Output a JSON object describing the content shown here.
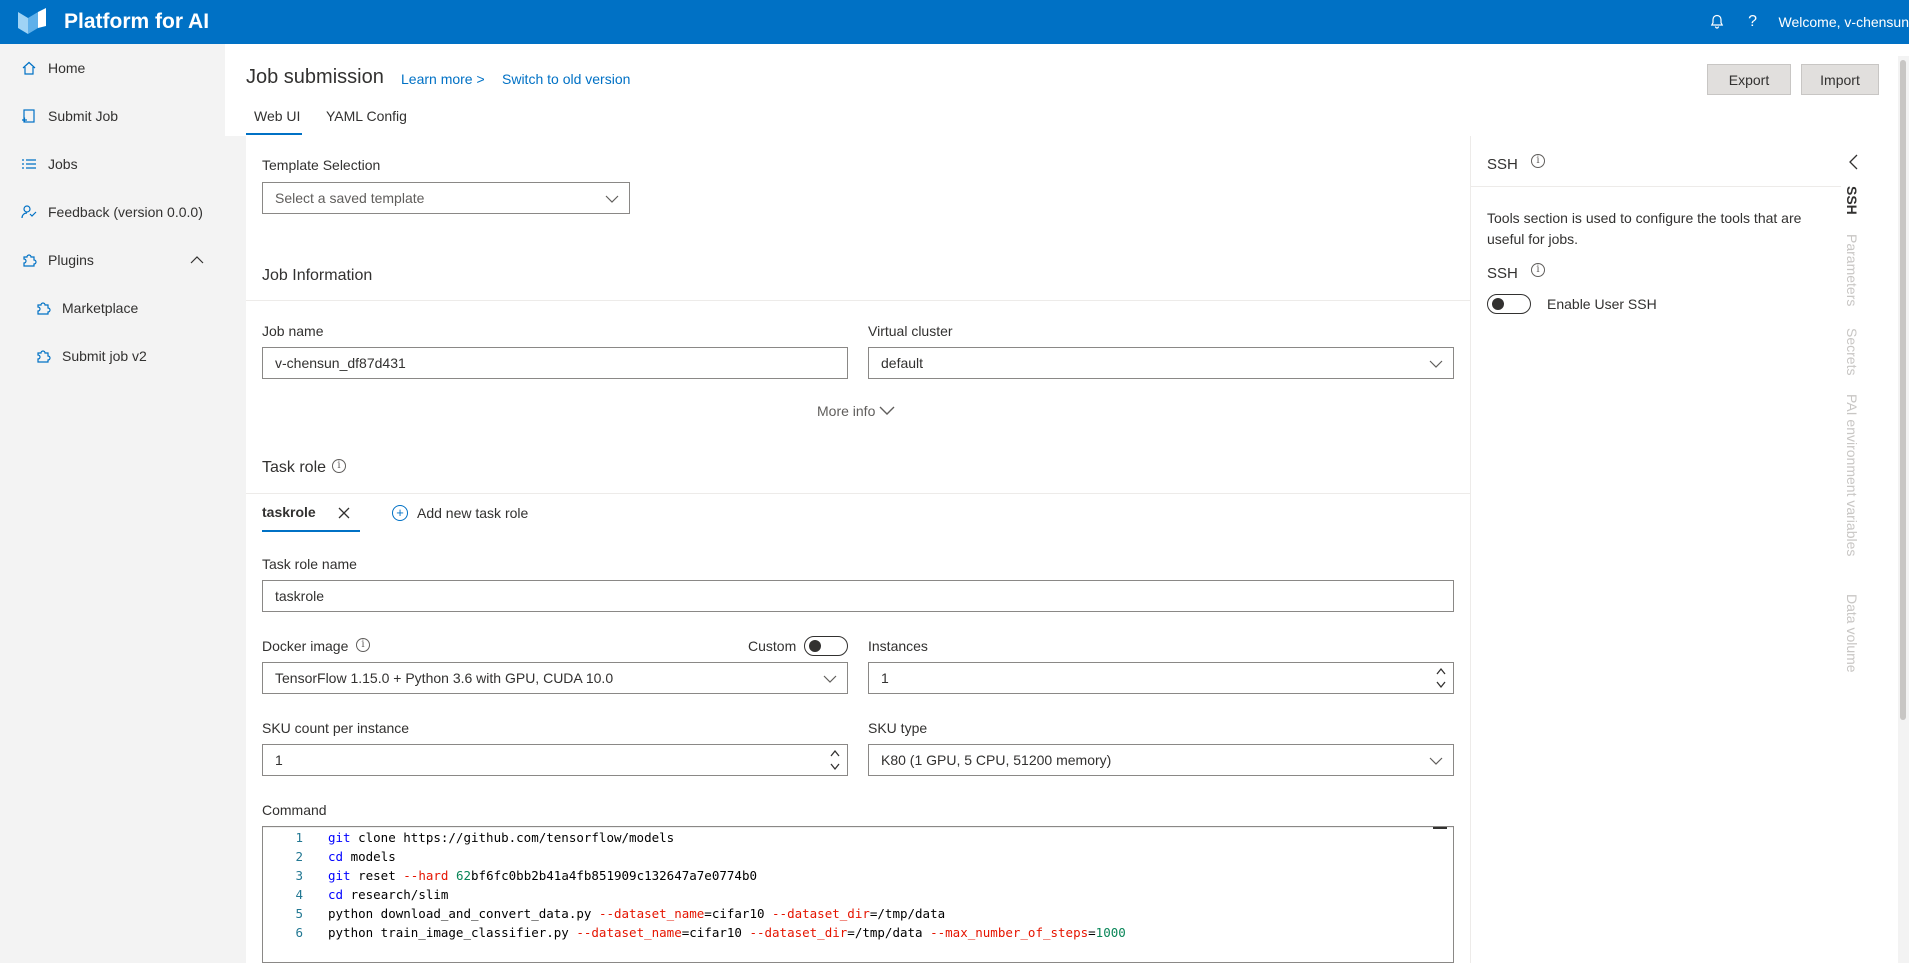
{
  "app": {
    "title": "Platform for AI",
    "welcome": "Welcome, v-chensun"
  },
  "sidebar": {
    "items": [
      {
        "label": "Home"
      },
      {
        "label": "Submit Job"
      },
      {
        "label": "Jobs"
      },
      {
        "label": "Feedback (version 0.0.0)"
      },
      {
        "label": "Plugins"
      },
      {
        "label": "Marketplace"
      },
      {
        "label": "Submit job v2"
      }
    ]
  },
  "header": {
    "title": "Job submission",
    "learn_more": "Learn more >",
    "switch_old": "Switch to old version",
    "export": "Export",
    "import": "Import",
    "tabs": [
      {
        "label": "Web UI"
      },
      {
        "label": "YAML Config"
      }
    ]
  },
  "form": {
    "template_label": "Template Selection",
    "template_placeholder": "Select a saved template",
    "job_info_title": "Job Information",
    "job_name_label": "Job name",
    "job_name_value": "v-chensun_df87d431",
    "vc_label": "Virtual cluster",
    "vc_value": "default",
    "more_info": "More info",
    "task_role_title": "Task role",
    "task_role_tab": "taskrole",
    "add_task_role": "Add new task role",
    "task_role_name_label": "Task role name",
    "task_role_name_value": "taskrole",
    "docker_label": "Docker image",
    "custom_label": "Custom",
    "docker_value": "TensorFlow 1.15.0 + Python 3.6 with GPU, CUDA 10.0",
    "instances_label": "Instances",
    "instances_value": "1",
    "sku_count_label": "SKU count per instance",
    "sku_count_value": "1",
    "sku_type_label": "SKU type",
    "sku_type_value": "K80 (1 GPU, 5 CPU, 51200 memory)",
    "command_label": "Command"
  },
  "command_lines": [
    {
      "n": "1",
      "parts": [
        {
          "t": "git",
          "c": "kw"
        },
        {
          "t": " clone https://github.com/tensorflow/models",
          "c": ""
        }
      ]
    },
    {
      "n": "2",
      "parts": [
        {
          "t": "cd",
          "c": "kw"
        },
        {
          "t": " models",
          "c": ""
        }
      ]
    },
    {
      "n": "3",
      "parts": [
        {
          "t": "git",
          "c": "kw"
        },
        {
          "t": " reset ",
          "c": ""
        },
        {
          "t": "--hard",
          "c": "flag"
        },
        {
          "t": " ",
          "c": ""
        },
        {
          "t": "62",
          "c": "num"
        },
        {
          "t": "bf6fc0bb2b41a4fb851909c132647a7e0774b0",
          "c": ""
        }
      ]
    },
    {
      "n": "4",
      "parts": [
        {
          "t": "cd",
          "c": "kw"
        },
        {
          "t": " research/slim",
          "c": ""
        }
      ]
    },
    {
      "n": "5",
      "parts": [
        {
          "t": "python download_and_convert_data.py ",
          "c": ""
        },
        {
          "t": "--dataset_name",
          "c": "flag"
        },
        {
          "t": "=cifar10 ",
          "c": ""
        },
        {
          "t": "--dataset_dir",
          "c": "flag"
        },
        {
          "t": "=/tmp/data",
          "c": ""
        }
      ]
    },
    {
      "n": "6",
      "parts": [
        {
          "t": "python train_image_classifier.py ",
          "c": ""
        },
        {
          "t": "--dataset_name",
          "c": "flag"
        },
        {
          "t": "=cifar10 ",
          "c": ""
        },
        {
          "t": "--dataset_dir",
          "c": "flag"
        },
        {
          "t": "=/tmp/data ",
          "c": ""
        },
        {
          "t": "--max_number_of_steps",
          "c": "flag"
        },
        {
          "t": "=",
          "c": ""
        },
        {
          "t": "1000",
          "c": "num"
        }
      ]
    }
  ],
  "right_panel": {
    "title": "SSH",
    "description": "Tools section is used to configure the tools that are useful for jobs.",
    "ssh_label": "SSH",
    "enable_ssh": "Enable User SSH",
    "vtabs": [
      {
        "label": "SSH"
      },
      {
        "label": "Parameters"
      },
      {
        "label": "Secrets"
      },
      {
        "label": "PAI environment variables"
      },
      {
        "label": "Data volume"
      }
    ]
  },
  "colors": {
    "brand": "#0071c5",
    "sidebar_bg": "#f3f3f3"
  }
}
